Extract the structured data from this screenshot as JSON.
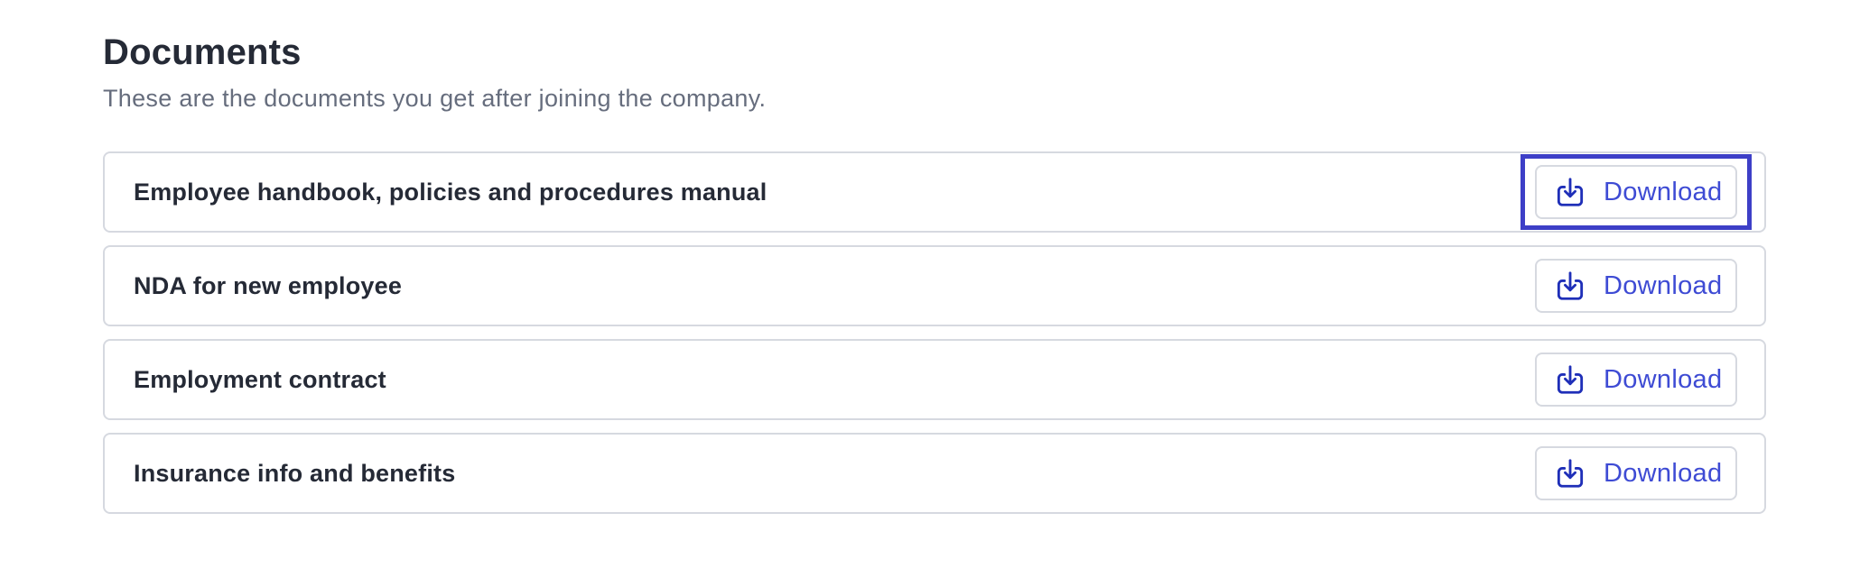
{
  "header": {
    "title": "Documents",
    "subtitle": "These are the documents you get after joining the company."
  },
  "documents": [
    {
      "name": "Employee handbook, policies and procedures manual",
      "action_label": "Download"
    },
    {
      "name": "NDA for new employee",
      "action_label": "Download"
    },
    {
      "name": "Employment contract",
      "action_label": "Download"
    },
    {
      "name": "Insurance info and benefits",
      "action_label": "Download"
    }
  ],
  "colors": {
    "accent": "#3e4bd4",
    "focus_ring": "#3d3fc7",
    "icon": "#1f2fb8"
  },
  "icons": {
    "download": "download-icon"
  }
}
